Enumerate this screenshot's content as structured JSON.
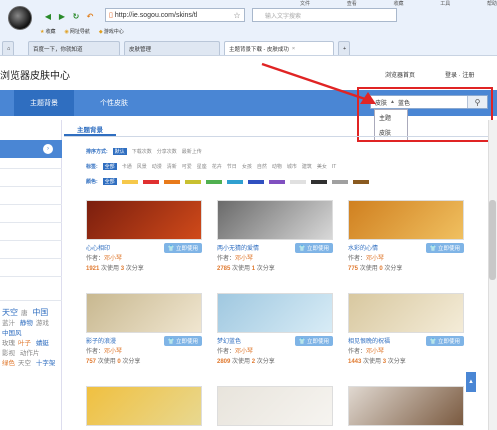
{
  "browser": {
    "menu": [
      "文件",
      "查看",
      "收藏",
      "工具",
      "帮助"
    ],
    "address": "http://ie.sogou.com/skins/tl",
    "search_placeholder": "输入文字搜索",
    "favorites": [
      "收藏",
      "网址导航",
      "游戏中心"
    ],
    "tabs": [
      {
        "label": "百度一下，你就知道"
      },
      {
        "label": "皮肤管理"
      },
      {
        "label": "主题背景下载 - 皮肤成功"
      }
    ],
    "new_tab": "+"
  },
  "page": {
    "site_title": "浏览器皮肤中心",
    "browser_link": "浏览器首页",
    "login": "登录",
    "register": "注册",
    "nav_theme": "主题背景",
    "nav_skin": "个性皮肤",
    "search_select": "皮肤",
    "search_value": "蓝色",
    "dropdown": [
      "主题",
      "皮肤"
    ],
    "section_title": "主题背景",
    "sort_label": "排序方式:",
    "sort_options": [
      "默认",
      "下载次数",
      "分享次数",
      "最新上传"
    ],
    "tag_label": "标签:",
    "tag_all": "全部",
    "tags": [
      "卡通",
      "风景",
      "动漫",
      "清新",
      "可爱",
      "星座",
      "花卉",
      "节日",
      "女孩",
      "自然",
      "动物",
      "城市",
      "建筑",
      "美女",
      "IT"
    ],
    "color_label": "颜色:",
    "color_all": "全部",
    "colors": [
      "#f6c84a",
      "#e03030",
      "#e87a1a",
      "#c8c030",
      "#50b050",
      "#30a0d0",
      "#3050c0",
      "#8050c0",
      "#e0e0e0",
      "#303030",
      "#a0a0a0",
      "#8a5a20"
    ],
    "sidebar_tags": [
      "天空",
      "唐",
      "中国",
      "蓝汁",
      "静物",
      "游戏",
      "中国风",
      "玫瑰",
      "叶子",
      "蜻蜓",
      "影视",
      "动作片",
      "绿色",
      "天空",
      "十字架"
    ]
  },
  "cards": [
    {
      "name": "心心相印",
      "author": "邓小琴",
      "uses": "1921",
      "shares": "3",
      "colors": [
        "#7a1e0e",
        "#d04a1a"
      ]
    },
    {
      "name": "两小无猜的爱情",
      "author": "邓小琴",
      "uses": "2785",
      "shares": "1",
      "colors": [
        "#6a6a6a",
        "#d8d8d8"
      ]
    },
    {
      "name": "水彩的心情",
      "author": "邓小琴",
      "uses": "775",
      "shares": "0",
      "colors": [
        "#d08020",
        "#f0c060"
      ]
    },
    {
      "name": "影子的浪漫",
      "author": "邓小琴",
      "uses": "757",
      "shares": "0",
      "colors": [
        "#c8b890",
        "#f0e6d0"
      ]
    },
    {
      "name": "梦幻蓝色",
      "author": "邓小琴",
      "uses": "2809",
      "shares": "2",
      "colors": [
        "#a0c8e0",
        "#d8ecf6"
      ]
    },
    {
      "name": "相见恨晚的祝福",
      "author": "邓小琴",
      "uses": "1443",
      "shares": "3",
      "colors": [
        "#d8c8a0",
        "#f4ecd8"
      ]
    },
    {
      "name": "",
      "author": "",
      "uses": "",
      "shares": "",
      "colors": [
        "#f0c040",
        "#e8d890"
      ]
    },
    {
      "name": "",
      "author": "",
      "uses": "",
      "shares": "",
      "colors": [
        "#e8e4dc",
        "#f6f4f0"
      ]
    },
    {
      "name": "",
      "author": "",
      "uses": "",
      "shares": "",
      "colors": [
        "#e0d8d0",
        "#7a5a40"
      ]
    }
  ],
  "labels": {
    "author_prefix": "作者：",
    "use_suffix": "次使用",
    "share_suffix": "次分享",
    "use_btn": "立即使用"
  }
}
